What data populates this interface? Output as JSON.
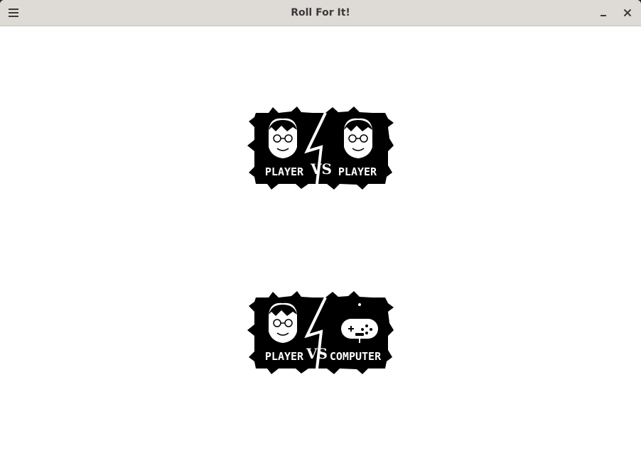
{
  "window": {
    "title": "Roll For It!",
    "icons": {
      "menu": "hamburger-menu-icon",
      "minimize": "minimize-icon",
      "close": "close-icon"
    }
  },
  "modes": [
    {
      "left": "PLAYER",
      "vs": "VS",
      "right": "PLAYER",
      "left_icon": "player-face-icon",
      "right_icon": "player-face-icon"
    },
    {
      "left": "PLAYER",
      "vs": "VS",
      "right": "COMPUTER",
      "left_icon": "player-face-icon",
      "right_icon": "gamepad-icon"
    }
  ],
  "colors": {
    "titlebar": "#dedbd6",
    "background": "#ffffff",
    "badge": "#000000",
    "text": "#ffffff"
  }
}
